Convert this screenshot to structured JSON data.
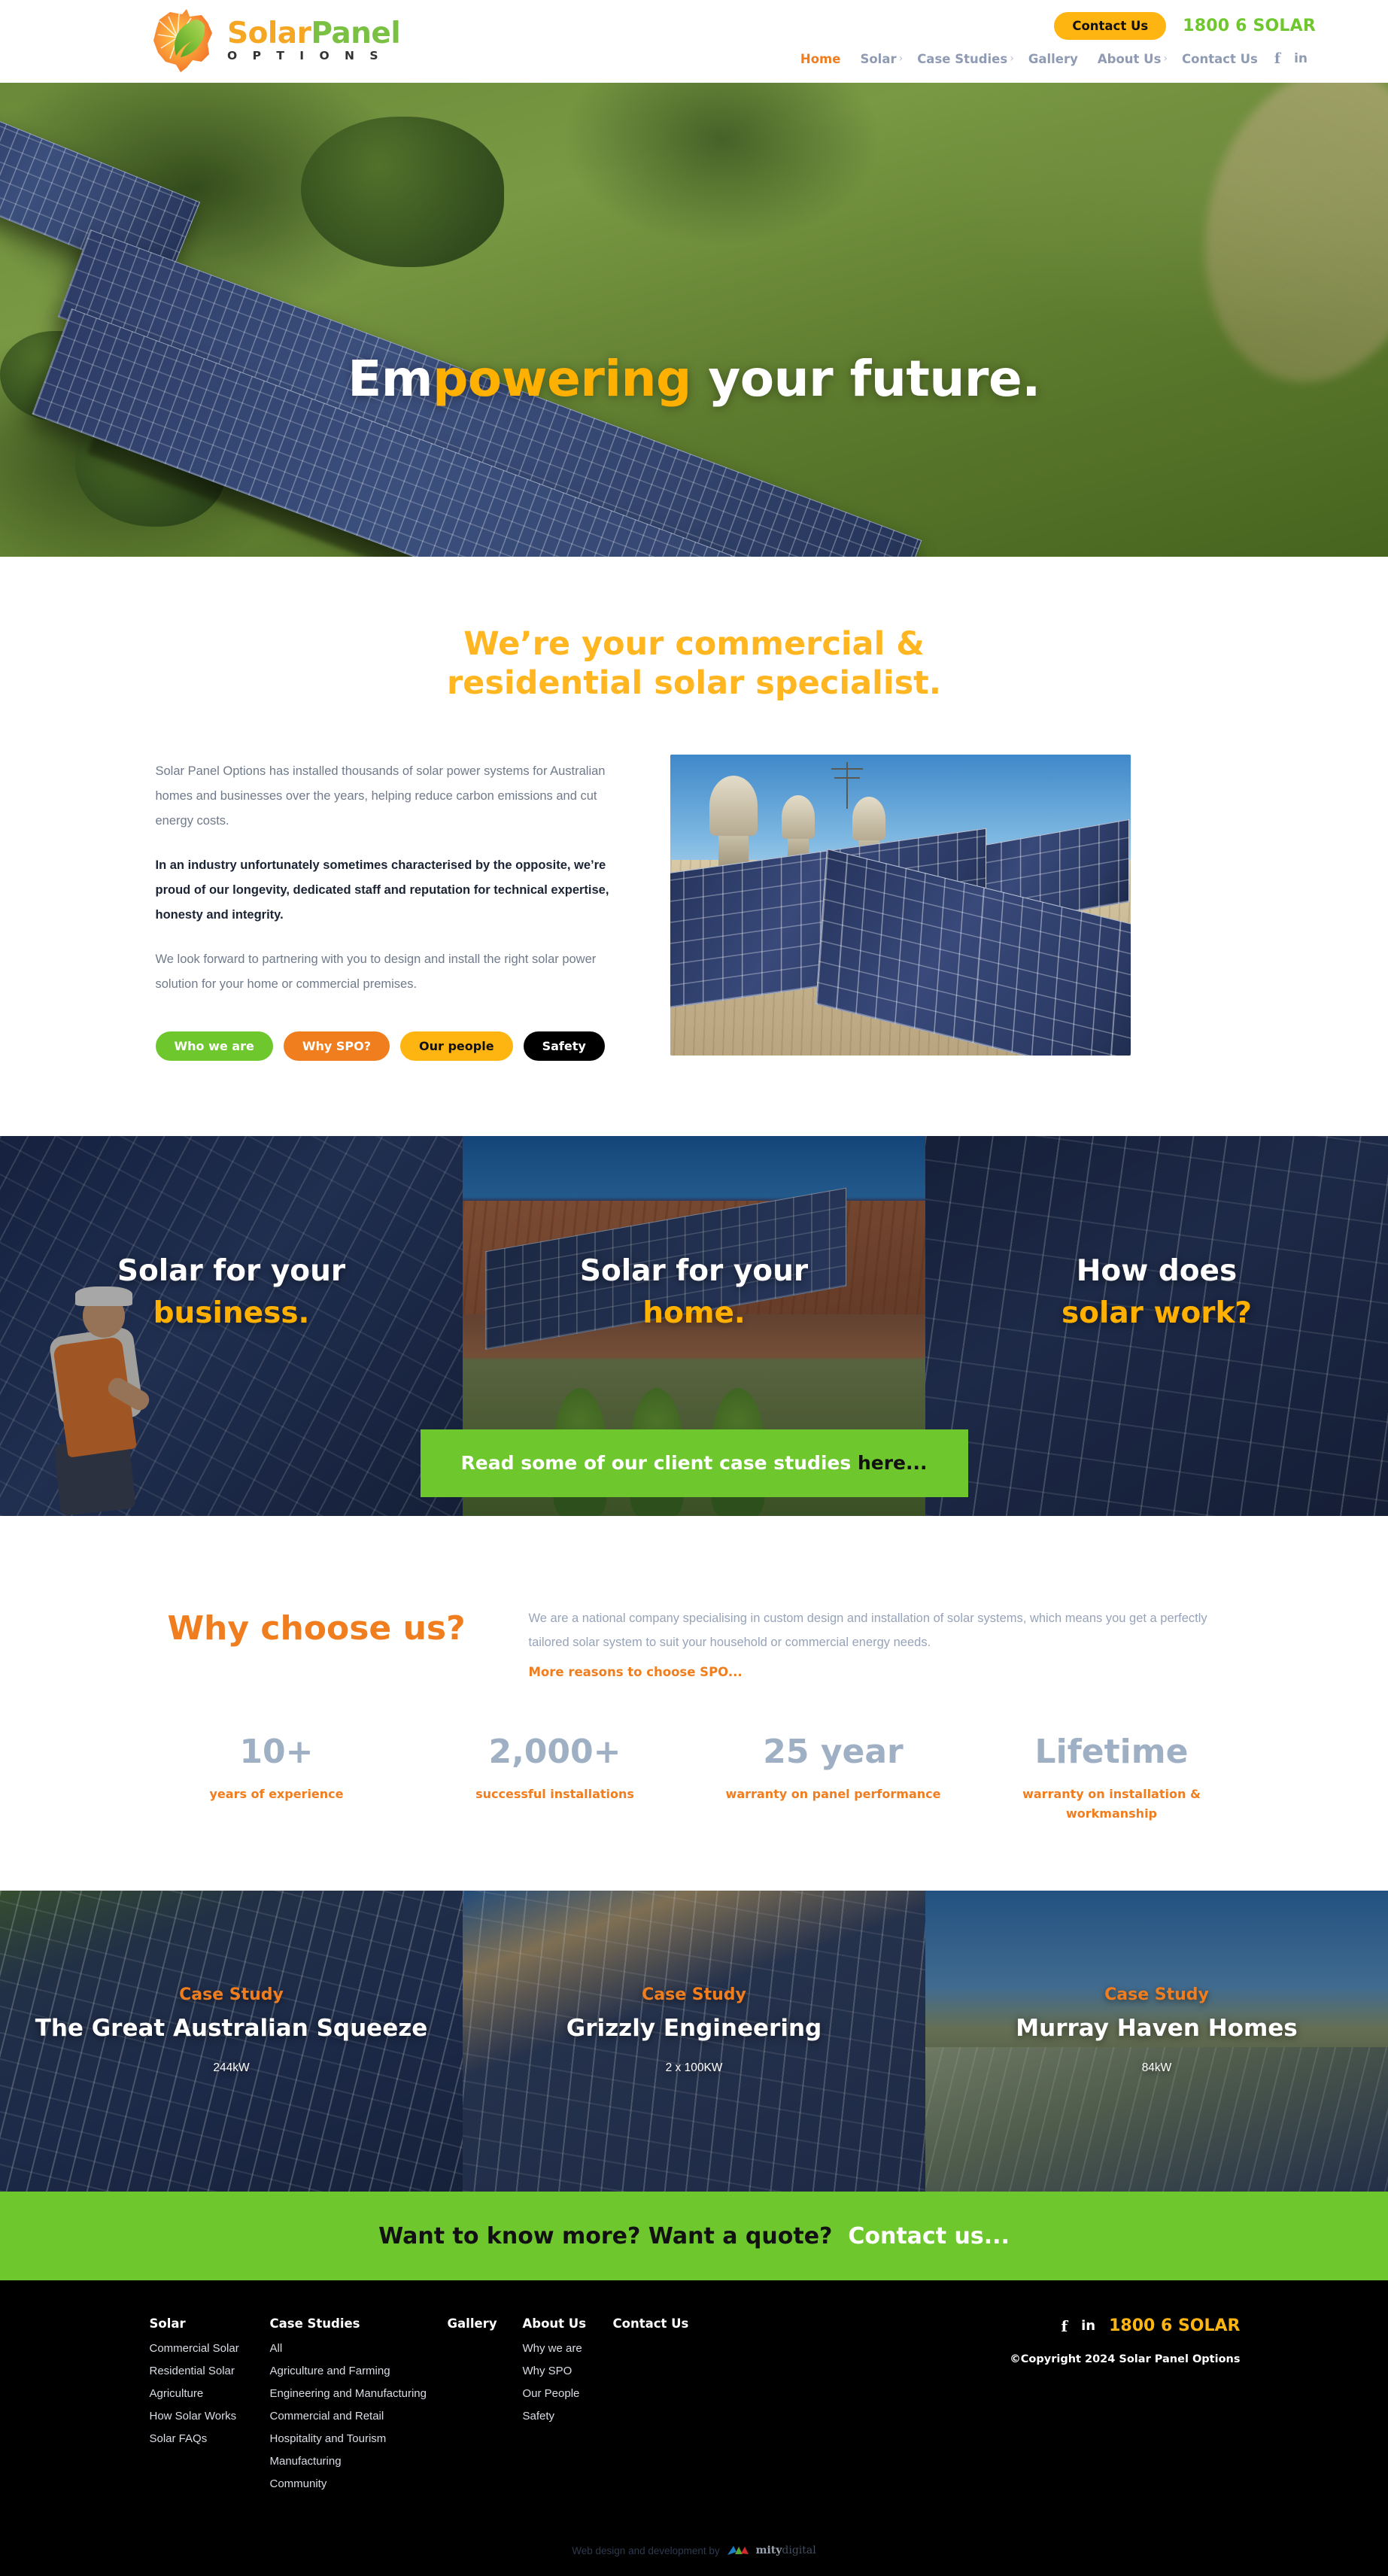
{
  "header": {
    "logo": {
      "word_part_1": "Solar",
      "word_part_2": "Panel",
      "subtitle": "O P T I O N S"
    },
    "contact_button": "Contact Us",
    "phone": "1800 6 SOLAR",
    "nav": [
      {
        "label": "Home",
        "caret": false,
        "active": true
      },
      {
        "label": "Solar",
        "caret": true,
        "active": false
      },
      {
        "label": "Case Studies",
        "caret": true,
        "active": false
      },
      {
        "label": "Gallery",
        "caret": false,
        "active": false
      },
      {
        "label": "About Us",
        "caret": true,
        "active": false
      },
      {
        "label": "Contact Us",
        "caret": false,
        "active": false
      }
    ],
    "social": {
      "facebook": "f",
      "linkedin": "in"
    }
  },
  "hero": {
    "title_part_1": "Em",
    "title_highlight": "powering",
    "title_part_2": " your future."
  },
  "intro": {
    "heading_line_1": "We’re your commercial &",
    "heading_line_2": "residential solar specialist.",
    "paragraph_1": "Solar Panel Options has installed thousands of solar power systems for Australian homes and businesses over the years, helping reduce carbon emissions and cut energy costs.",
    "paragraph_2": "In an industry unfortunately sometimes characterised by the opposite, we’re proud of our longevity, dedicated staff and reputation for technical expertise, honesty and integrity.",
    "paragraph_3": "We look forward to partnering with you to design and install the right solar power solution for your home or commercial premises.",
    "buttons": [
      {
        "label": "Who we are",
        "color": "#6fc72e"
      },
      {
        "label": "Why SPO?",
        "color": "#f07d1e"
      },
      {
        "label": "Our people",
        "color": "#ffb511"
      },
      {
        "label": "Safety",
        "color": "#000000"
      }
    ]
  },
  "tiles": [
    {
      "line_1": "Solar for your",
      "line_2": "business."
    },
    {
      "line_1": "Solar for your",
      "line_2": "home."
    },
    {
      "line_1": "How does",
      "line_2": "solar work?"
    }
  ],
  "cta_band": {
    "text": "Read some of our client case studies ",
    "link": "here..."
  },
  "why": {
    "title": "Why choose us?",
    "paragraph": "We are a national company specialising in custom design and installation of solar systems, which means you get a perfectly tailored solar system to suit your household or commercial energy needs.",
    "link": "More reasons to choose SPO...",
    "stats": [
      {
        "value": "10+",
        "label": "years of experience"
      },
      {
        "value": "2,000+",
        "label": "successful installations"
      },
      {
        "value": "25 year",
        "label": "warranty on panel performance"
      },
      {
        "value": "Lifetime",
        "label": "warranty on installation & workmanship"
      }
    ]
  },
  "case_studies": [
    {
      "kicker": "Case Study",
      "title": "The Great Australian Squeeze",
      "size": "244kW"
    },
    {
      "kicker": "Case Study",
      "title": "Grizzly Engineering",
      "size": "2 x 100KW"
    },
    {
      "kicker": "Case Study",
      "title": "Murray Haven Homes",
      "size": "84kW"
    }
  ],
  "contact_banner": {
    "question": "Want to know more? Want a quote?",
    "link": "Contact us..."
  },
  "footer": {
    "columns": [
      {
        "heading": "Solar",
        "items": [
          "Commercial Solar",
          "Residential Solar",
          "Agriculture",
          "How Solar Works",
          "Solar FAQs"
        ]
      },
      {
        "heading": "Case Studies",
        "items": [
          "All",
          "Agriculture and Farming",
          "Engineering and Manufacturing",
          "Commercial and Retail",
          "Hospitality and Tourism",
          "Manufacturing",
          "Community"
        ]
      },
      {
        "heading": "Gallery",
        "items": []
      },
      {
        "heading": "About Us",
        "items": [
          "Why we are",
          "Why SPO",
          "Our People",
          "Safety"
        ]
      },
      {
        "heading": "Contact Us",
        "items": []
      }
    ],
    "social": {
      "facebook": "f",
      "linkedin": "in"
    },
    "phone": "1800 6 SOLAR",
    "copyright": "©Copyright 2024 Solar Panel Options",
    "credit_text": "Web design and development by",
    "credit_brand_bold": "mity",
    "credit_brand_light": "digital"
  },
  "colors": {
    "orange": "#f07d1e",
    "amber": "#ffb511",
    "green": "#6fc72e",
    "nav_grey": "#8f9bb3",
    "stat_grey": "#9fb0c4"
  }
}
